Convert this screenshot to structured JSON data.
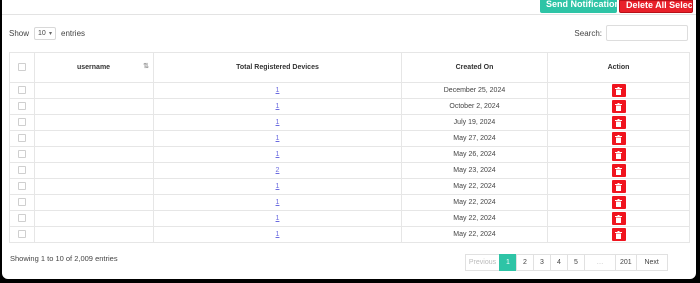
{
  "toolbar": {
    "send_notifications_label": "Send Notifications",
    "delete_all_selected_label": "Delete All Selected"
  },
  "length": {
    "show_label": "Show",
    "value": "10",
    "entries_label": "entries"
  },
  "search": {
    "label": "Search:",
    "value": ""
  },
  "table": {
    "headers": {
      "username": "username",
      "total_devices": "Total Registered Devices",
      "created_on": "Created On",
      "action": "Action"
    },
    "rows": [
      {
        "username": "",
        "devices": "1",
        "created_on": "December 25, 2024"
      },
      {
        "username": "",
        "devices": "1",
        "created_on": "October 2, 2024"
      },
      {
        "username": "",
        "devices": "1",
        "created_on": "July 19, 2024"
      },
      {
        "username": "",
        "devices": "1",
        "created_on": "May 27, 2024"
      },
      {
        "username": "",
        "devices": "1",
        "created_on": "May 26, 2024"
      },
      {
        "username": "",
        "devices": "2",
        "created_on": "May 23, 2024"
      },
      {
        "username": "",
        "devices": "1",
        "created_on": "May 22, 2024"
      },
      {
        "username": "",
        "devices": "1",
        "created_on": "May 22, 2024"
      },
      {
        "username": "",
        "devices": "1",
        "created_on": "May 22, 2024"
      },
      {
        "username": "",
        "devices": "1",
        "created_on": "May 22, 2024"
      }
    ]
  },
  "footer": {
    "info": "Showing 1 to 10 of 2,009 entries"
  },
  "pagination": {
    "previous": "Previous",
    "pages": [
      "1",
      "2",
      "3",
      "4",
      "5"
    ],
    "ellipsis": "…",
    "last": "201",
    "next": "Next",
    "active": "1"
  },
  "colors": {
    "accent": "#2ec4a6",
    "danger": "#e8202a"
  }
}
